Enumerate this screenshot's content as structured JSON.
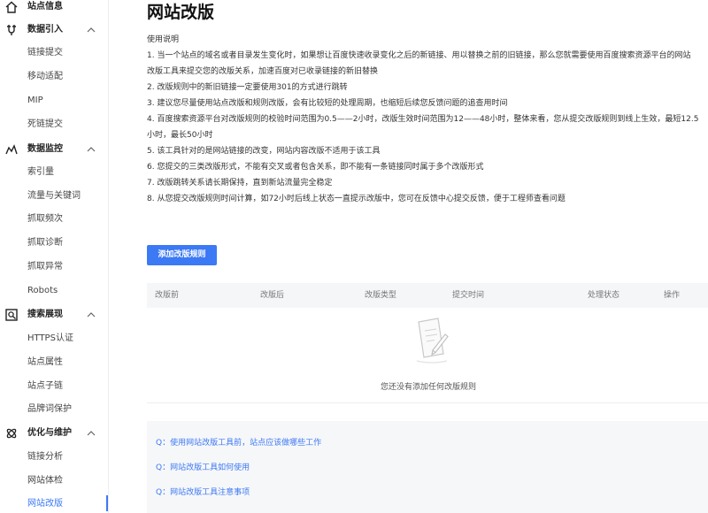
{
  "sidebar": {
    "sections": [
      {
        "label": "站点信息",
        "icon": "home-icon"
      },
      {
        "label": "数据引入",
        "icon": "data-import-icon",
        "items": [
          "链接提交",
          "移动适配",
          "MIP",
          "死链提交"
        ]
      },
      {
        "label": "数据监控",
        "icon": "monitor-chart-icon",
        "items": [
          "索引量",
          "流量与关键词",
          "抓取频次",
          "抓取诊断",
          "抓取异常",
          "Robots"
        ]
      },
      {
        "label": "搜索展现",
        "icon": "search-display-icon",
        "items": [
          "HTTPS认证",
          "站点属性",
          "站点子链",
          "品牌词保护"
        ]
      },
      {
        "label": "优化与维护",
        "icon": "optimize-icon",
        "items": [
          "链接分析",
          "网站体检",
          "网站改版"
        ]
      }
    ],
    "active_item": "网站改版"
  },
  "main": {
    "title": "网站改版",
    "instructions": [
      "使用说明",
      "1. 当一个站点的域名或者目录发生变化时，如果想让百度快速收录变化之后的新链接、用以替换之前的旧链接，那么您就需要使用百度搜索资源平台的网站",
      "改版工具来提交您的改版关系，加速百度对已收录链接的新旧替换",
      "2. 改版规则中的新旧链接一定要使用301的方式进行跳转",
      "3. 建议您尽量使用站点改版和规则改版，会有比较短的处理周期，也缩短后续您反馈问题的追查用时间",
      "4. 百度搜索资源平台对改版规则的校验时间范围为0.5——2小时，改版生效时间范围为12——48小时，整体来看，您从提交改版规则到线上生效，最短12.5",
      "小时，最长50小时",
      "5. 该工具针对的是网站链接的改变，网站内容改版不适用于该工具",
      "6. 您提交的三类改版形式，不能有交叉或者包含关系，即不能有一条链接同时属于多个改版形式",
      "7. 改版跳转关系请长期保持，直到新站流量完全稳定",
      "8. 从您提交改版规则时间计算，如72小时后线上状态一直提示改版中，您可在反馈中心提交反馈，便于工程师查看问题"
    ],
    "add_button": "添加改版规则",
    "table_headers": [
      "改版前",
      "改版后",
      "改版类型",
      "提交时间",
      "处理状态",
      "操作"
    ],
    "empty_text": "您还没有添加任何改版规则",
    "faqs": [
      "Q：使用网站改版工具前，站点应该做哪些工作",
      "Q：网站改版工具如何使用",
      "Q：网站改版工具注意事项"
    ]
  },
  "colors": {
    "accent": "#3c79f5",
    "header_bg": "#f5f6f8",
    "faq_bg": "#f6f7f9"
  }
}
